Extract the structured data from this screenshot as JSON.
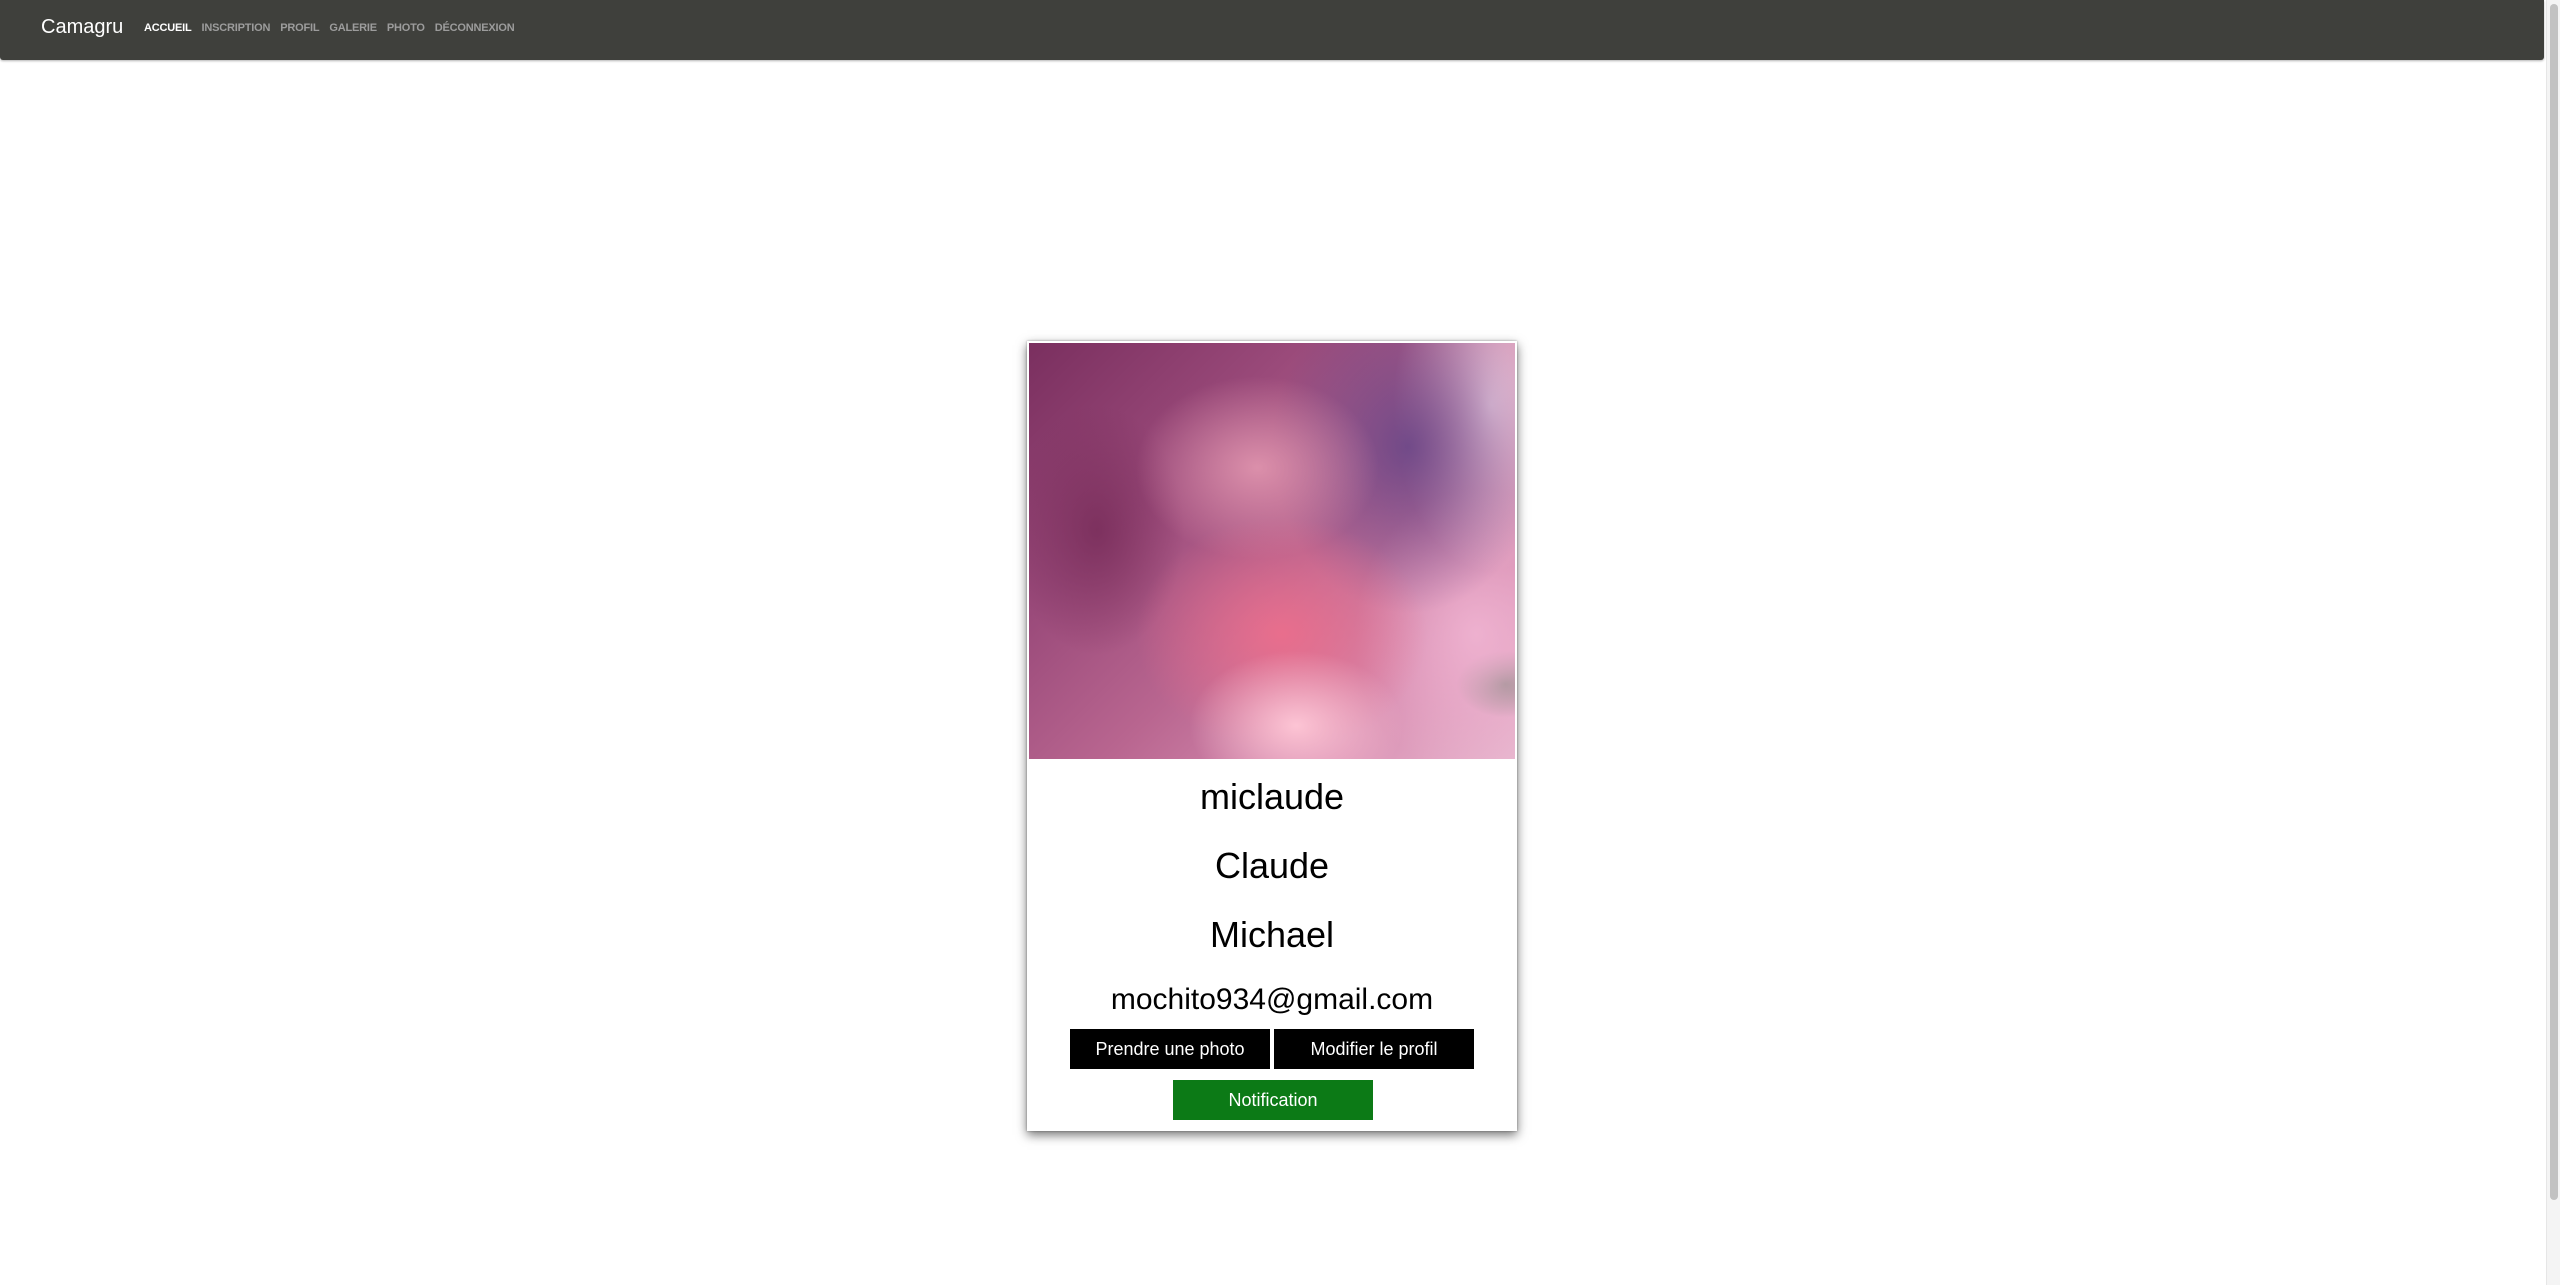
{
  "navbar": {
    "brand": "Camagru",
    "links": [
      {
        "label": "ACCUEIL",
        "active": true
      },
      {
        "label": "INSCRIPTION",
        "active": false
      },
      {
        "label": "PROFIL",
        "active": false
      },
      {
        "label": "GALERIE",
        "active": false
      },
      {
        "label": "PHOTO",
        "active": false
      },
      {
        "label": "DÉCONNEXION",
        "active": false
      }
    ]
  },
  "profile": {
    "username": "miclaude",
    "first_name": "Claude",
    "last_name": "Michael",
    "email": "mochito934@gmail.com",
    "photo_icon": "pink-smoke-photo"
  },
  "actions": {
    "take_photo_label": "Prendre une photo",
    "edit_profile_label": "Modifier le profil",
    "notification_label": "Notification"
  },
  "colors": {
    "navbar_bg": "#3f403c",
    "button_dark": "#000000",
    "button_green": "#0c7a16"
  }
}
